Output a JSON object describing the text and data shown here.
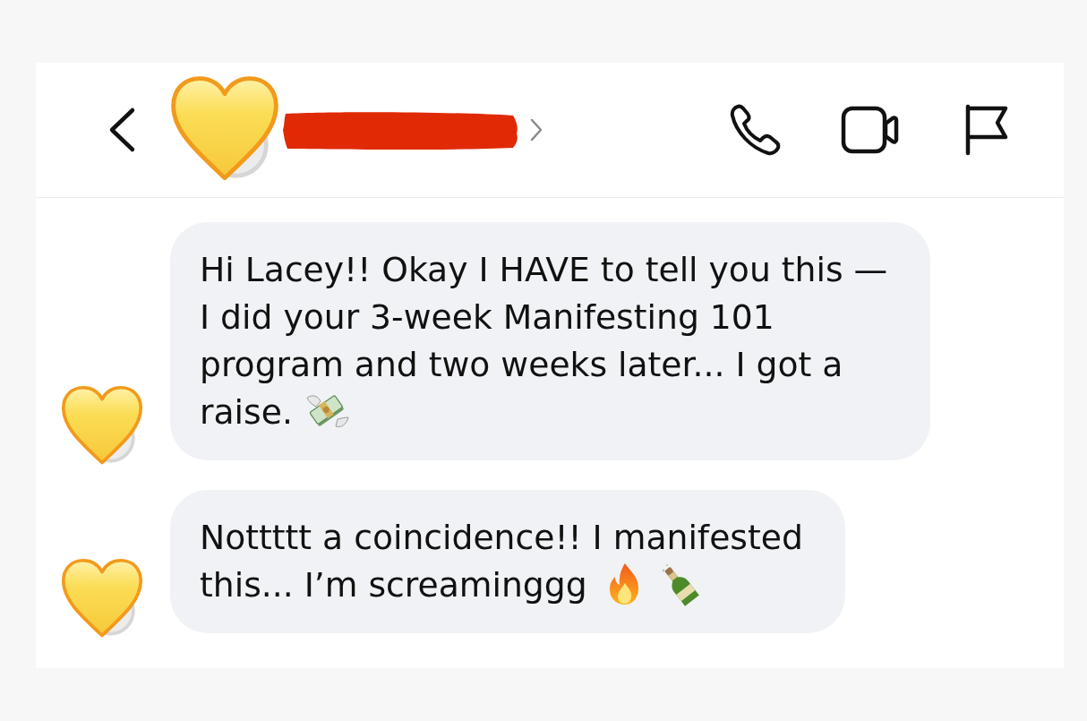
{
  "header": {
    "contact_name_redacted": true
  },
  "messages": [
    {
      "kind": "incoming",
      "parts": [
        {
          "kind": "text",
          "text": "Hi Lacey!! Okay I HAVE to tell you this — I did your 3-week Manifesting 101 program and two weeks later... I got a raise."
        },
        {
          "kind": "money"
        }
      ]
    },
    {
      "kind": "incoming",
      "parts": [
        {
          "kind": "text",
          "text": "Nottttt a coincidence!! I manifested this... I’m screaminggg"
        },
        {
          "kind": "fire"
        },
        {
          "kind": "champagne"
        }
      ]
    }
  ]
}
